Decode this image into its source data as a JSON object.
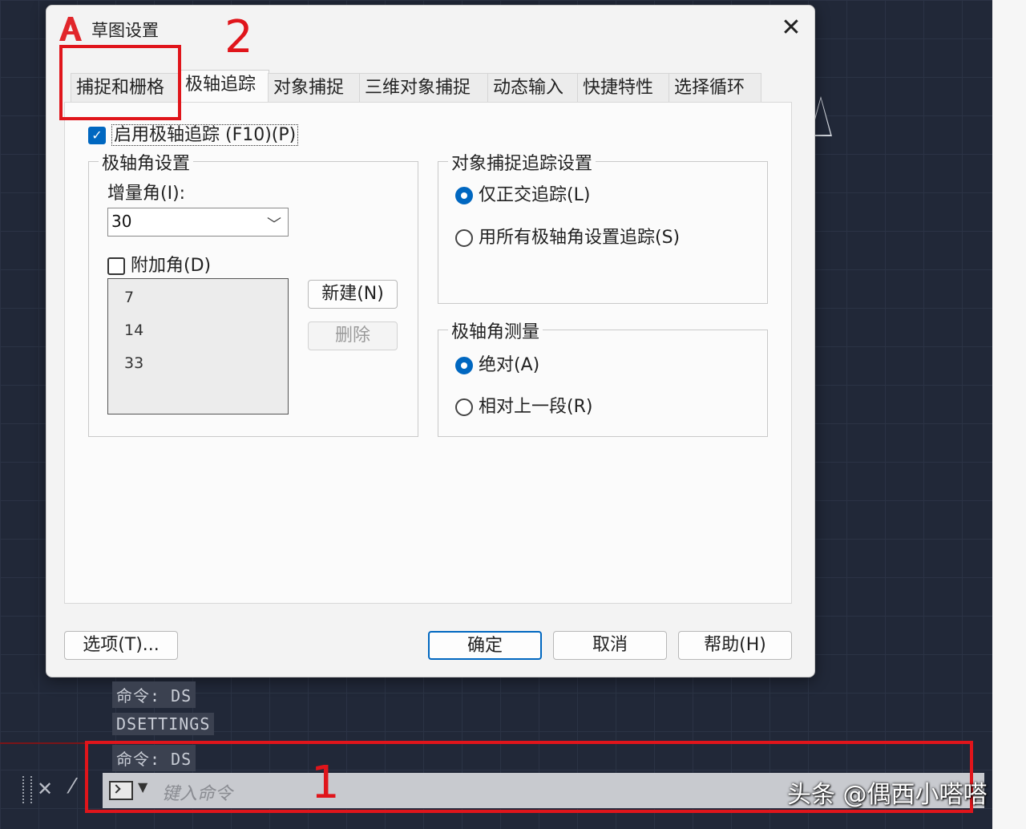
{
  "dialog": {
    "title": "草图设置",
    "close_symbol": "✕",
    "tabs": [
      "捕捉和栅格",
      "极轴追踪",
      "对象捕捉",
      "三维对象捕捉",
      "动态输入",
      "快捷特性",
      "选择循环"
    ],
    "active_tab": "极轴追踪",
    "enable_polar": {
      "label": "启用极轴追踪 (F10)(P)",
      "checked": true
    },
    "polar_angle_settings": {
      "title": "极轴角设置",
      "increment_label": "增量角(I):",
      "increment_value": "30",
      "additional_label": "附加角(D)",
      "additional_checked": false,
      "additional_angles": [
        "7",
        "14",
        "33"
      ],
      "new_button": "新建(N)",
      "delete_button": "删除"
    },
    "object_snap_tracking": {
      "title": "对象捕捉追踪设置",
      "options": [
        "仅正交追踪(L)",
        "用所有极轴角设置追踪(S)"
      ],
      "selected": 0
    },
    "polar_angle_measurement": {
      "title": "极轴角测量",
      "options": [
        "绝对(A)",
        "相对上一段(R)"
      ],
      "selected": 0
    },
    "footer": {
      "options_button": "选项(T)...",
      "ok_button": "确定",
      "cancel_button": "取消",
      "help_button": "帮助(H)"
    }
  },
  "command_line": {
    "history": [
      "命令: DS",
      "DSETTINGS",
      "命令: DS"
    ],
    "placeholder": "键入命令",
    "close_symbol": "✕"
  },
  "annotations": {
    "marker_1": "1",
    "marker_2": "2",
    "color": "#e0151b"
  },
  "watermark": "头条 @偶西小嗒嗒",
  "colors": {
    "accent": "#0067c0",
    "canvas": "#212838"
  }
}
